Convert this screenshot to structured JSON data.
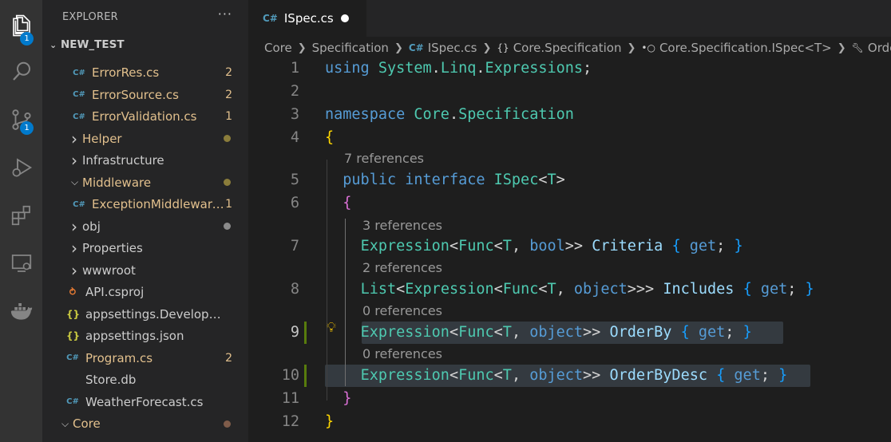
{
  "activity_bar": {
    "explorer_badge": "1",
    "scm_badge": "1"
  },
  "sidebar": {
    "title": "EXPLORER",
    "more": "···",
    "folder": "NEW_TEST",
    "rows": [
      {
        "type": "file",
        "label": "ErrorRes.cs",
        "icon": "C",
        "count": "2",
        "color": "#e2c08d"
      },
      {
        "type": "file",
        "label": "ErrorSource.cs",
        "icon": "C",
        "count": "2",
        "color": "#e2c08d"
      },
      {
        "type": "file",
        "label": "ErrorValidation.cs",
        "icon": "C",
        "count": "1",
        "color": "#e2c08d"
      },
      {
        "type": "folder",
        "label": "Helper",
        "expanded": false,
        "color": "#e2c08d"
      },
      {
        "type": "folder",
        "label": "Infrastructure",
        "expanded": false,
        "color": "#cccccc"
      },
      {
        "type": "folder",
        "label": "Middleware",
        "expanded": true,
        "color": "#e2c08d"
      },
      {
        "type": "file",
        "label": "ExceptionMiddleware.cs",
        "icon": "C",
        "count": "1",
        "color": "#e2c08d"
      },
      {
        "type": "folder",
        "label": "obj",
        "expanded": false,
        "color": "#cccccc"
      },
      {
        "type": "folder",
        "label": "Properties",
        "expanded": false,
        "color": "#cccccc"
      },
      {
        "type": "folder",
        "label": "wwwroot",
        "expanded": false,
        "color": "#cccccc"
      },
      {
        "type": "file",
        "label": "API.csproj",
        "icon": "rss",
        "color": "#cccccc"
      },
      {
        "type": "file",
        "label": "appsettings.Development.json",
        "icon": "{}",
        "color": "#cccccc"
      },
      {
        "type": "file",
        "label": "appsettings.json",
        "icon": "{}",
        "color": "#cccccc"
      },
      {
        "type": "file",
        "label": "Program.cs",
        "icon": "C",
        "count": "2",
        "color": "#e2c08d"
      },
      {
        "type": "file",
        "label": "Store.db",
        "icon": "",
        "color": "#cccccc"
      },
      {
        "type": "file",
        "label": "WeatherForecast.cs",
        "icon": "C",
        "color": "#cccccc"
      },
      {
        "type": "folder",
        "label": "Core",
        "expanded": true,
        "color": "#e2c08d"
      }
    ]
  },
  "tab": {
    "label": "ISpec.cs"
  },
  "breadcrumbs": [
    "Core",
    "Specification",
    "ISpec.cs",
    "Core.Specification",
    "Core.Specification.ISpec<T>",
    "OrderBy"
  ],
  "code": {
    "lens": [
      "7 references",
      "3 references",
      "2 references",
      "0 references",
      "0 references"
    ],
    "line_numbers": [
      "1",
      "2",
      "3",
      "4",
      "5",
      "6",
      "7",
      "8",
      "9",
      "10",
      "11",
      "12"
    ]
  }
}
